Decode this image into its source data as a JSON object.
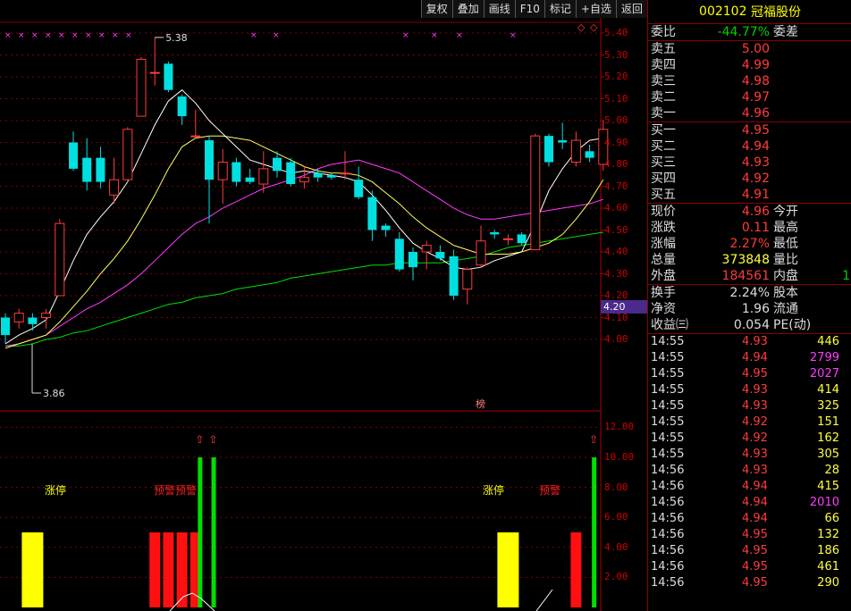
{
  "toolbar": [
    "复权",
    "叠加",
    "画线",
    "F10",
    "标记",
    "+自选",
    "返回"
  ],
  "stock": {
    "code": "002102",
    "name": "冠福股份"
  },
  "weibi": {
    "label": "委比",
    "value": "-44.77%",
    "label2": "委差"
  },
  "asks": [
    {
      "label": "卖五",
      "price": "5.00"
    },
    {
      "label": "卖四",
      "price": "4.99"
    },
    {
      "label": "卖三",
      "price": "4.98"
    },
    {
      "label": "卖二",
      "price": "4.97"
    },
    {
      "label": "卖一",
      "price": "4.96"
    }
  ],
  "bids": [
    {
      "label": "买一",
      "price": "4.95"
    },
    {
      "label": "买二",
      "price": "4.94"
    },
    {
      "label": "买三",
      "price": "4.93"
    },
    {
      "label": "买四",
      "price": "4.92"
    },
    {
      "label": "买五",
      "price": "4.91"
    }
  ],
  "quote": [
    {
      "l": "现价",
      "v": "4.96",
      "l2": "今开",
      "cls": "red"
    },
    {
      "l": "涨跌",
      "v": "0.11",
      "l2": "最高",
      "cls": "red"
    },
    {
      "l": "涨幅",
      "v": "2.27%",
      "l2": "最低",
      "cls": "red"
    },
    {
      "l": "总量",
      "v": "373848",
      "l2": "量比",
      "cls": "yellow"
    },
    {
      "l": "外盘",
      "v": "184561",
      "l2": "内盘",
      "cls": "red",
      "v2": "1",
      "v2cls": "green"
    }
  ],
  "fin": [
    {
      "l": "换手",
      "v": "2.24%",
      "l2": "股本"
    },
    {
      "l": "净资",
      "v": "1.96",
      "l2": "流通"
    },
    {
      "l": "收益㈢",
      "v": "0.054",
      "l2": "PE(动)"
    }
  ],
  "ticks": [
    {
      "t": "14:55",
      "p": "4.93",
      "v": "446",
      "c": "yellow"
    },
    {
      "t": "14:55",
      "p": "4.94",
      "v": "2799",
      "c": "magenta"
    },
    {
      "t": "14:55",
      "p": "4.95",
      "v": "2027",
      "c": "magenta"
    },
    {
      "t": "14:55",
      "p": "4.93",
      "v": "414",
      "c": "yellow"
    },
    {
      "t": "14:55",
      "p": "4.93",
      "v": "325",
      "c": "yellow"
    },
    {
      "t": "14:55",
      "p": "4.92",
      "v": "151",
      "c": "yellow"
    },
    {
      "t": "14:55",
      "p": "4.92",
      "v": "162",
      "c": "yellow"
    },
    {
      "t": "14:55",
      "p": "4.93",
      "v": "305",
      "c": "yellow"
    },
    {
      "t": "14:56",
      "p": "4.93",
      "v": "28",
      "c": "yellow"
    },
    {
      "t": "14:56",
      "p": "4.94",
      "v": "415",
      "c": "yellow"
    },
    {
      "t": "14:56",
      "p": "4.94",
      "v": "2010",
      "c": "magenta"
    },
    {
      "t": "14:56",
      "p": "4.94",
      "v": "66",
      "c": "yellow"
    },
    {
      "t": "14:56",
      "p": "4.95",
      "v": "132",
      "c": "yellow"
    },
    {
      "t": "14:56",
      "p": "4.95",
      "v": "186",
      "c": "yellow"
    },
    {
      "t": "14:56",
      "p": "4.95",
      "v": "461",
      "c": "yellow"
    },
    {
      "t": "14:56",
      "p": "4.95",
      "v": "290",
      "c": "yellow"
    }
  ],
  "chart": {
    "y_ticks": [
      "5.40",
      "5.30",
      "5.20",
      "5.10",
      "5.00",
      "4.90",
      "4.80",
      "4.70",
      "4.60",
      "4.50",
      "4.40",
      "4.30",
      "4.20",
      "4.10",
      "4.00"
    ],
    "y2_ticks": [
      "12.00",
      "10.00",
      "8.00",
      "6.00",
      "4.00",
      "2.00"
    ],
    "high_label": "5.38",
    "low_label": "3.86",
    "current_marker": "4.20",
    "bang_label": "榜",
    "sig_labels": [
      {
        "text": "涨停",
        "color": "#ffff00"
      },
      {
        "text": "预警预警",
        "color": "#ff2020"
      },
      {
        "text": "涨停",
        "color": "#ffff00"
      },
      {
        "text": "预警",
        "color": "#ff2020"
      }
    ]
  },
  "chart_data": {
    "type": "candlestick",
    "ylim": [
      3.92,
      5.45
    ],
    "candles": [
      [
        4.1,
        4.02,
        4.12,
        3.98
      ],
      [
        4.08,
        4.12,
        4.14,
        4.05
      ],
      [
        4.1,
        4.07,
        4.12,
        4.04
      ],
      [
        4.1,
        4.12,
        4.14,
        4.05
      ],
      [
        4.2,
        4.53,
        4.55,
        4.2
      ],
      [
        4.9,
        4.78,
        4.95,
        4.77
      ],
      [
        4.83,
        4.72,
        4.92,
        4.68
      ],
      [
        4.83,
        4.72,
        4.88,
        4.69
      ],
      [
        4.66,
        4.73,
        4.83,
        4.62
      ],
      [
        4.73,
        4.96,
        4.97,
        4.72
      ],
      [
        5.02,
        5.28,
        5.29,
        5.02
      ],
      [
        5.22,
        5.22,
        5.38,
        5.16
      ],
      [
        5.26,
        5.14,
        5.27,
        5.13
      ],
      [
        5.11,
        5.02,
        5.12,
        4.98
      ],
      [
        4.93,
        4.93,
        5.05,
        4.92
      ],
      [
        4.91,
        4.73,
        4.93,
        4.53
      ],
      [
        4.73,
        4.81,
        4.87,
        4.62
      ],
      [
        4.81,
        4.72,
        4.83,
        4.7
      ],
      [
        4.74,
        4.72,
        4.78,
        4.71
      ],
      [
        4.71,
        4.78,
        4.86,
        4.67
      ],
      [
        4.83,
        4.77,
        4.86,
        4.74
      ],
      [
        4.81,
        4.71,
        4.83,
        4.7
      ],
      [
        4.72,
        4.74,
        4.79,
        4.69
      ],
      [
        4.76,
        4.74,
        4.78,
        4.72
      ],
      [
        4.75,
        4.74,
        4.76,
        4.73
      ],
      [
        4.76,
        4.76,
        4.86,
        4.73
      ],
      [
        4.73,
        4.65,
        4.79,
        4.64
      ],
      [
        4.65,
        4.5,
        4.68,
        4.45
      ],
      [
        4.52,
        4.5,
        4.53,
        4.47
      ],
      [
        4.46,
        4.32,
        4.49,
        4.31
      ],
      [
        4.4,
        4.33,
        4.42,
        4.27
      ],
      [
        4.4,
        4.43,
        4.45,
        4.32
      ],
      [
        4.4,
        4.37,
        4.43,
        4.36
      ],
      [
        4.38,
        4.2,
        4.41,
        4.18
      ],
      [
        4.23,
        4.32,
        4.33,
        4.16
      ],
      [
        4.34,
        4.45,
        4.52,
        4.33
      ],
      [
        4.49,
        4.48,
        4.5,
        4.46
      ],
      [
        4.46,
        4.46,
        4.48,
        4.43
      ],
      [
        4.48,
        4.44,
        4.49,
        4.43
      ],
      [
        4.41,
        4.93,
        4.94,
        4.41
      ],
      [
        4.93,
        4.81,
        4.94,
        4.79
      ],
      [
        4.91,
        4.9,
        4.99,
        4.87
      ],
      [
        4.81,
        4.91,
        4.95,
        4.79
      ],
      [
        4.86,
        4.83,
        4.89,
        4.81
      ],
      [
        4.8,
        4.96,
        5.0,
        4.77
      ]
    ],
    "ma_white": [
      3.98,
      4.02,
      4.05,
      4.09,
      4.22,
      4.36,
      4.48,
      4.56,
      4.63,
      4.72,
      4.85,
      4.98,
      5.09,
      5.14,
      5.08,
      5.0,
      4.94,
      4.88,
      4.82,
      4.8,
      4.78,
      4.76,
      4.77,
      4.76,
      4.75,
      4.74,
      4.72,
      4.66,
      4.59,
      4.51,
      4.44,
      4.4,
      4.37,
      4.33,
      4.32,
      4.33,
      4.36,
      4.38,
      4.4,
      4.53,
      4.68,
      4.78,
      4.86,
      4.91,
      4.92
    ],
    "ma_yellow": [
      3.96,
      3.98,
      4.0,
      4.02,
      4.08,
      4.15,
      4.22,
      4.3,
      4.37,
      4.45,
      4.55,
      4.66,
      4.78,
      4.88,
      4.92,
      4.93,
      4.93,
      4.92,
      4.91,
      4.88,
      4.85,
      4.82,
      4.79,
      4.77,
      4.76,
      4.76,
      4.75,
      4.72,
      4.67,
      4.62,
      4.56,
      4.51,
      4.47,
      4.43,
      4.41,
      4.39,
      4.39,
      4.39,
      4.4,
      4.42,
      4.44,
      4.48,
      4.55,
      4.63,
      4.73
    ],
    "ma_magenta": [
      3.97,
      3.98,
      4.0,
      4.02,
      4.06,
      4.1,
      4.14,
      4.17,
      4.21,
      4.25,
      4.3,
      4.36,
      4.42,
      4.48,
      4.53,
      4.56,
      4.6,
      4.63,
      4.66,
      4.69,
      4.71,
      4.73,
      4.75,
      4.78,
      4.8,
      4.81,
      4.82,
      4.8,
      4.78,
      4.76,
      4.72,
      4.68,
      4.64,
      4.6,
      4.57,
      4.55,
      4.55,
      4.56,
      4.57,
      4.58,
      4.59,
      4.6,
      4.61,
      4.62,
      4.64
    ],
    "ma_green": [
      3.97,
      3.97,
      3.98,
      4.0,
      4.01,
      4.03,
      4.04,
      4.06,
      4.08,
      4.1,
      4.12,
      4.14,
      4.16,
      4.17,
      4.19,
      4.2,
      4.21,
      4.23,
      4.24,
      4.25,
      4.26,
      4.28,
      4.29,
      4.3,
      4.31,
      4.32,
      4.33,
      4.34,
      4.34,
      4.35,
      4.35,
      4.35,
      4.35,
      4.36,
      4.37,
      4.38,
      4.4,
      4.42,
      4.43,
      4.44,
      4.45,
      4.46,
      4.47,
      4.48,
      4.49
    ],
    "sub_ylim": [
      0,
      13
    ],
    "yellow_bars": [
      {
        "i": 2,
        "v": 5.0
      },
      {
        "i": 37,
        "v": 5.0
      }
    ],
    "red_bars": [
      {
        "i": 11,
        "v": 5.0
      },
      {
        "i": 12,
        "v": 5.0
      },
      {
        "i": 13,
        "v": 5.0
      },
      {
        "i": 14,
        "v": 5.0
      },
      {
        "i": 42,
        "v": 5.0
      }
    ],
    "green_bars": [
      {
        "i": 14.3,
        "v": 10
      },
      {
        "i": 15.3,
        "v": 10
      },
      {
        "i": 43.3,
        "v": 10
      }
    ],
    "arrows": [
      14.3,
      15.3,
      43.3
    ]
  }
}
